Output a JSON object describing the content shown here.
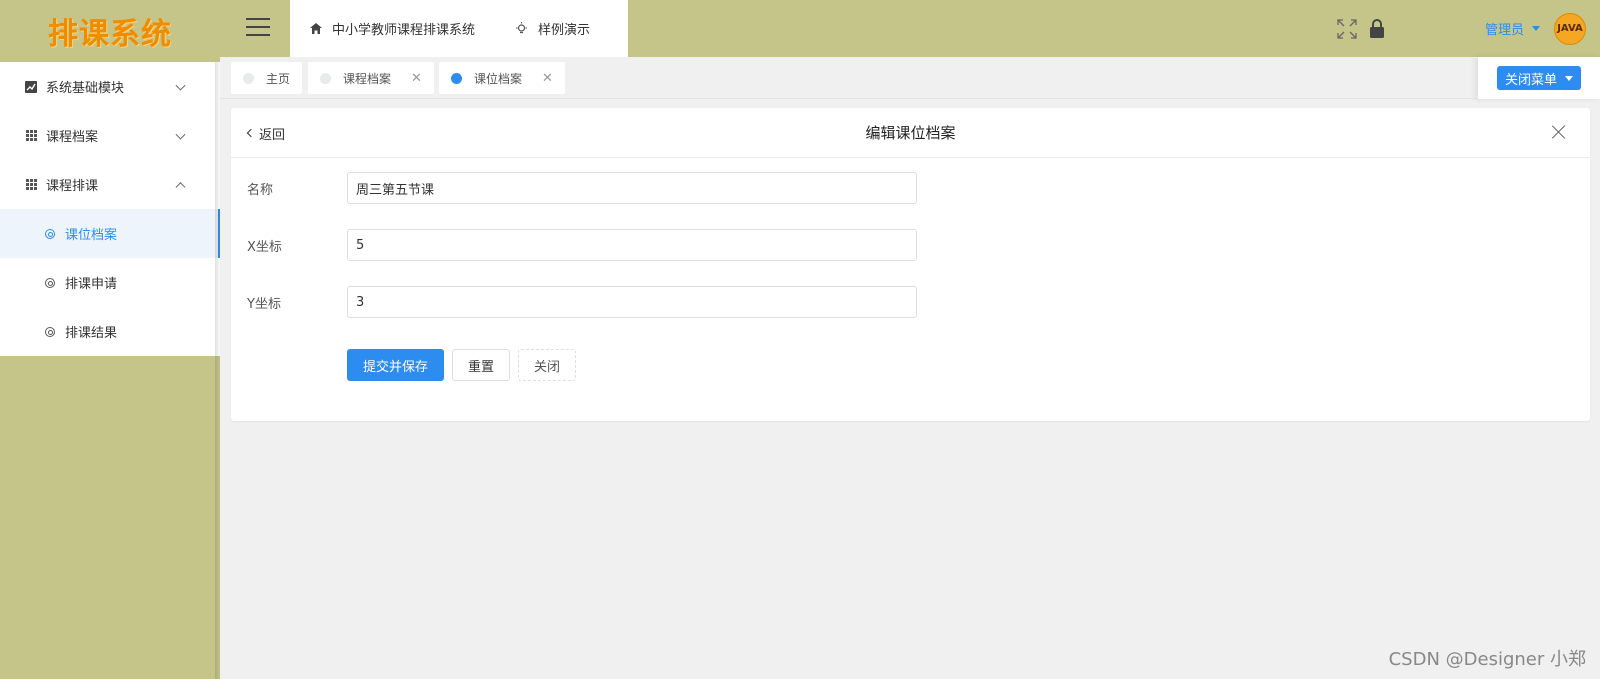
{
  "sidebar": {
    "logo": "排课系统",
    "items": [
      {
        "label": "系统基础模块"
      },
      {
        "label": "课程档案"
      },
      {
        "label": "课程排课"
      }
    ],
    "sub_items": [
      {
        "label": "课位档案"
      },
      {
        "label": "排课申请"
      },
      {
        "label": "排课结果"
      }
    ]
  },
  "header": {
    "nav": [
      {
        "label": "中小学教师课程排课系统"
      },
      {
        "label": "样例演示"
      }
    ],
    "user": "管理员",
    "avatar_text": "JAVA"
  },
  "tabs": [
    {
      "label": "主页"
    },
    {
      "label": "课程档案"
    },
    {
      "label": "课位档案"
    }
  ],
  "tabs_close_menu": "关闭菜单",
  "card": {
    "back": "返回",
    "title": "编辑课位档案",
    "fields": [
      {
        "label": "名称",
        "value": "周三第五节课"
      },
      {
        "label": "X坐标",
        "value": "5"
      },
      {
        "label": "Y坐标",
        "value": "3"
      }
    ],
    "buttons": {
      "submit": "提交并保存",
      "reset": "重置",
      "close": "关闭"
    }
  },
  "watermark": "CSDN @Designer 小郑",
  "colors": {
    "accent": "#2d8cf0",
    "frame": "#c5c58a",
    "logo": "#f08c00"
  }
}
